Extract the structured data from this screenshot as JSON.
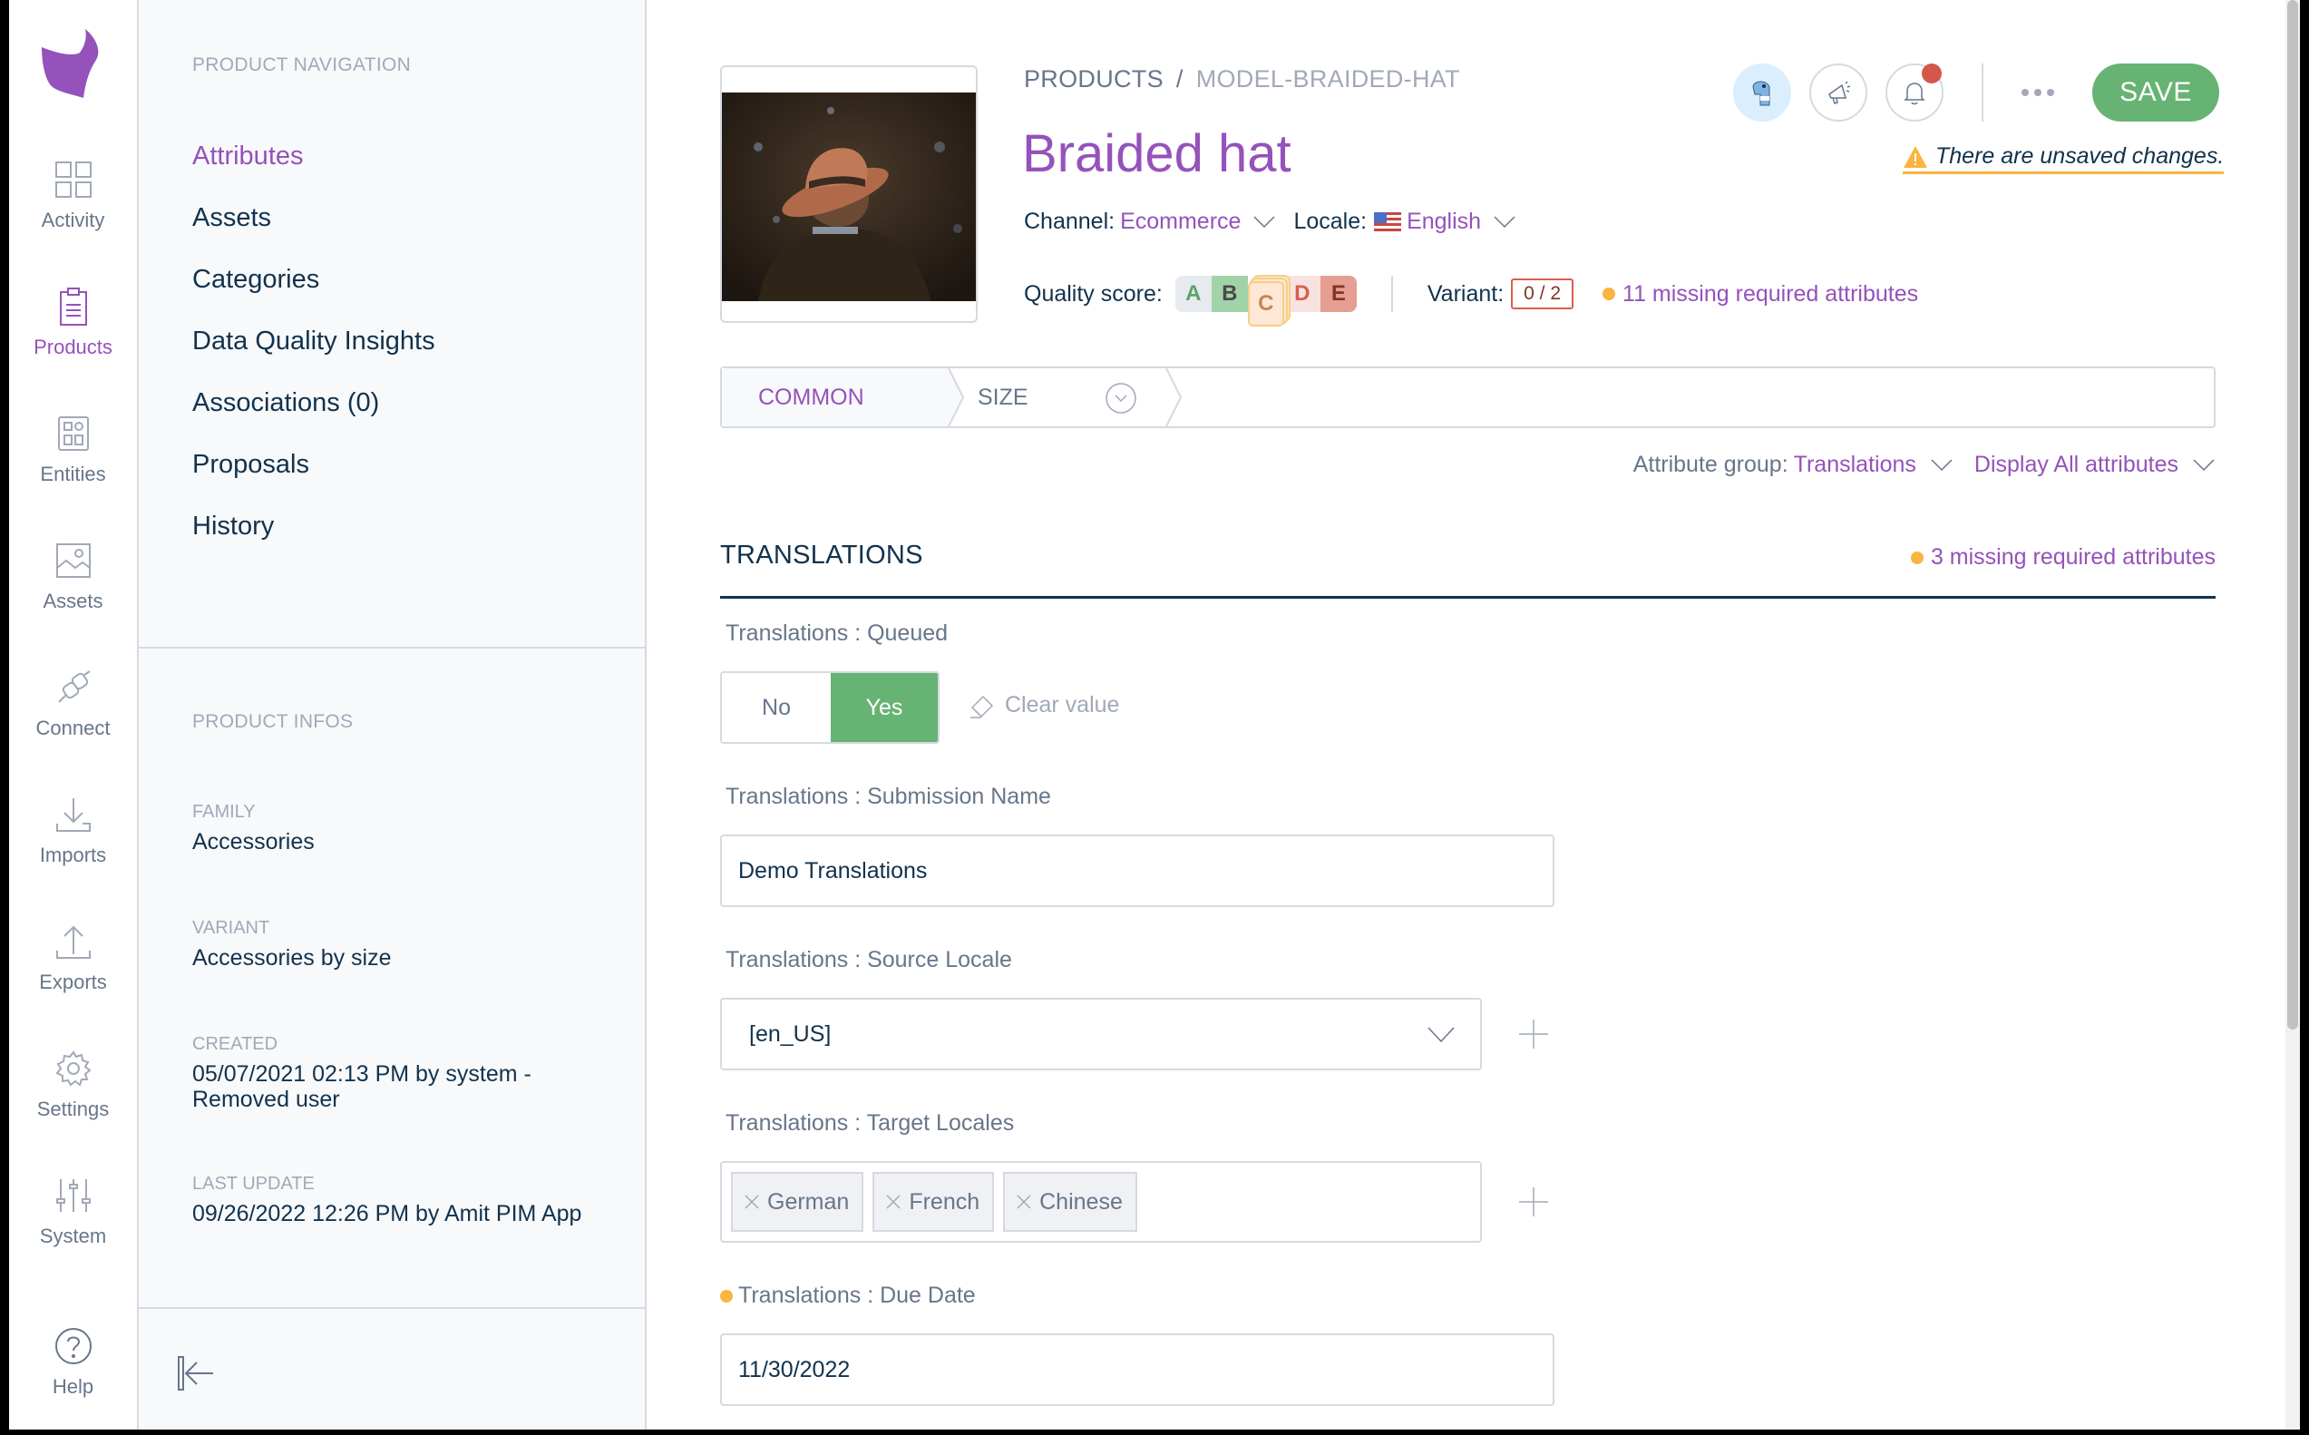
{
  "rail": {
    "items": [
      {
        "label": "Activity",
        "icon": "dashboard-icon"
      },
      {
        "label": "Products",
        "icon": "clipboard-icon",
        "active": true
      },
      {
        "label": "Entities",
        "icon": "entities-icon"
      },
      {
        "label": "Assets",
        "icon": "image-icon"
      },
      {
        "label": "Connect",
        "icon": "plug-icon"
      },
      {
        "label": "Imports",
        "icon": "import-icon"
      },
      {
        "label": "Exports",
        "icon": "export-icon"
      },
      {
        "label": "Settings",
        "icon": "gear-icon"
      },
      {
        "label": "System",
        "icon": "sliders-icon"
      }
    ],
    "help": "Help"
  },
  "nav": {
    "title": "PRODUCT NAVIGATION",
    "links": [
      "Attributes",
      "Assets",
      "Categories",
      "Data Quality Insights",
      "Associations (0)",
      "Proposals",
      "History"
    ],
    "active_link": "Attributes",
    "infos_title": "PRODUCT INFOS",
    "infos": [
      {
        "label": "FAMILY",
        "value": "Accessories"
      },
      {
        "label": "VARIANT",
        "value": "Accessories by size"
      },
      {
        "label": "CREATED",
        "value": "05/07/2021 02:13 PM by system - Removed user"
      },
      {
        "label": "LAST UPDATE",
        "value": "09/26/2022 12:26 PM by Amit PIM App"
      }
    ]
  },
  "header": {
    "breadcrumb": [
      "PRODUCTS",
      "/",
      "MODEL-BRAIDED-HAT"
    ],
    "title": "Braided hat",
    "channel_label": "Channel:",
    "channel_value": "Ecommerce",
    "locale_label": "Locale:",
    "locale_value": "English",
    "quality_label": "Quality score:",
    "grades": [
      "A",
      "B",
      "C",
      "D",
      "E"
    ],
    "current_grade": "C",
    "variant_label": "Variant:",
    "variant_value": "0 / 2",
    "missing": "11 missing required attributes",
    "save": "SAVE",
    "unsaved": "There are unsaved changes."
  },
  "tabs": {
    "common": "COMMON",
    "size": "SIZE"
  },
  "filters": {
    "group_label": "Attribute group:",
    "group_value": "Translations",
    "display_value": "Display All attributes"
  },
  "section": {
    "title": "TRANSLATIONS",
    "missing": "3 missing required attributes"
  },
  "fields": {
    "queued": {
      "label": "Translations : Queued",
      "no": "No",
      "yes": "Yes",
      "selected": "Yes",
      "clear": "Clear value"
    },
    "submission": {
      "label": "Translations : Submission Name",
      "value": "Demo Translations"
    },
    "source": {
      "label": "Translations : Source Locale",
      "value": "[en_US]"
    },
    "target": {
      "label": "Translations : Target Locales",
      "values": [
        "German",
        "French",
        "Chinese"
      ]
    },
    "due": {
      "label": "Translations : Due Date",
      "value": "11/30/2022",
      "required_missing": true
    }
  },
  "colors": {
    "accent": "#9452ba",
    "save_green": "#67b373",
    "warning": "#f9b53f",
    "text": "#11324d"
  }
}
